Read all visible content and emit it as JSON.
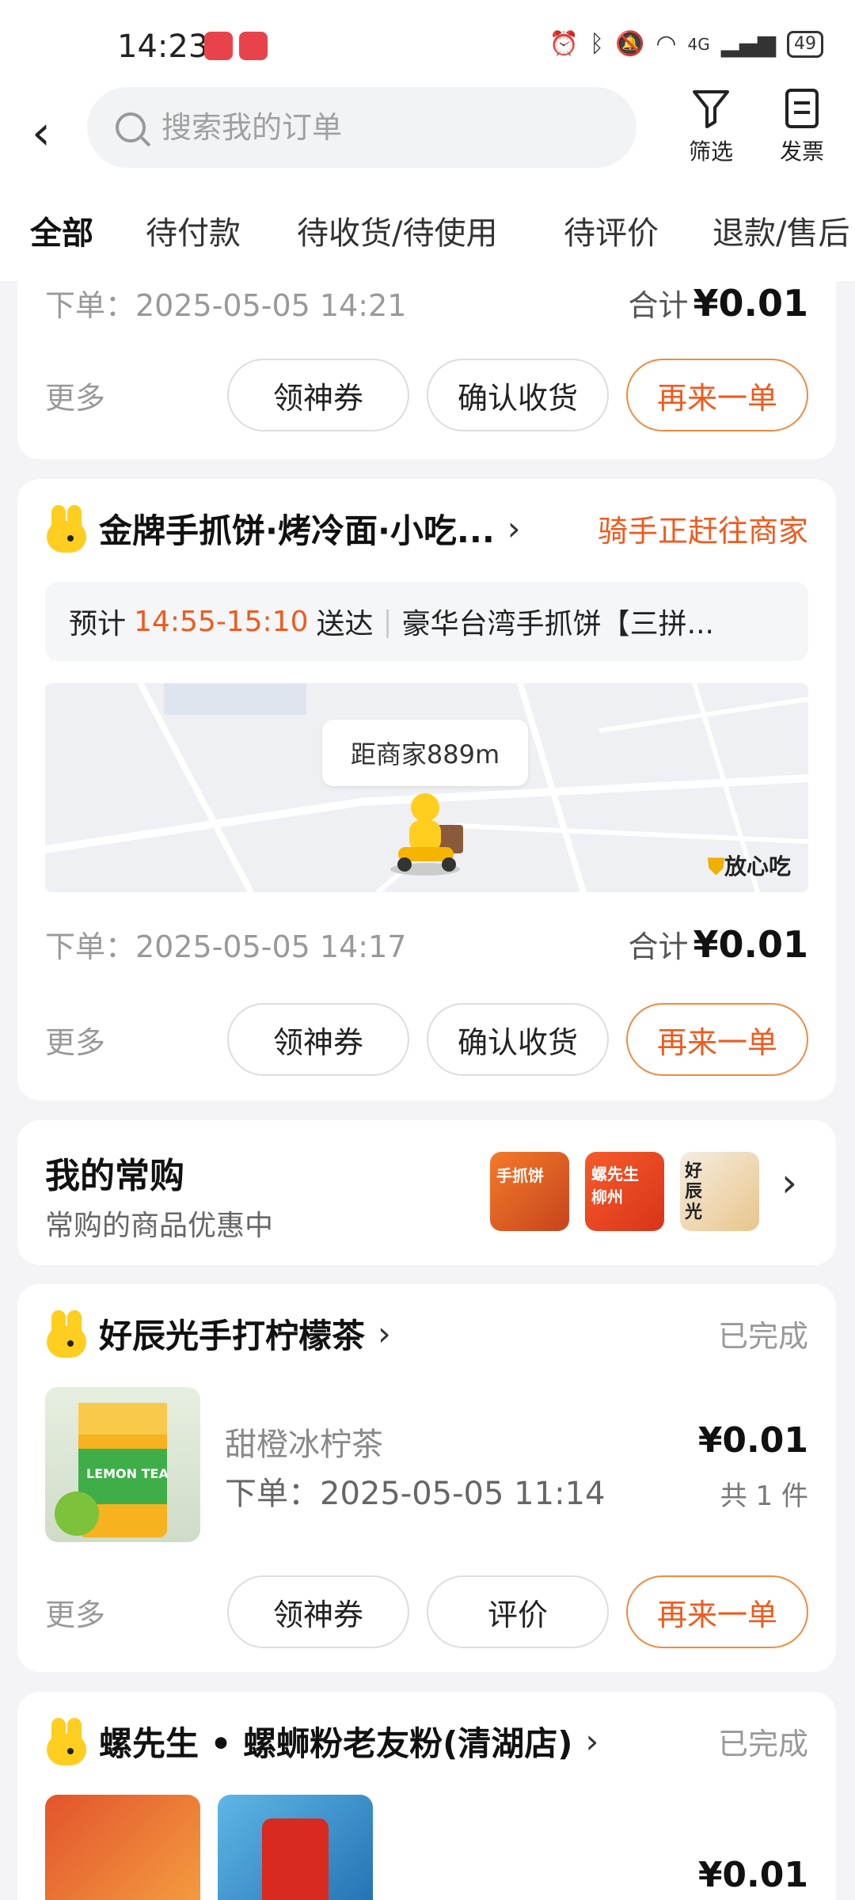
{
  "status_bar": {
    "time": "14:23",
    "battery": "49",
    "network": "4G"
  },
  "header": {
    "search_placeholder": "搜索我的订单",
    "filter_label": "筛选",
    "invoice_label": "发票"
  },
  "tabs": [
    "全部",
    "待付款",
    "待收货/待使用",
    "待评价",
    "退款/售后"
  ],
  "colors": {
    "accent": "#f05a1e",
    "tab_underline": "#ffd100",
    "brand_yellow": "#ffce1f"
  },
  "order1": {
    "order_time": "下单：2025-05-05 14:21",
    "total_label": "合计",
    "total": "¥0.01",
    "more": "更多",
    "buttons": [
      "领神券",
      "确认收货",
      "再来一单"
    ]
  },
  "order2": {
    "store": "金牌手抓饼·烤冷面·小吃...",
    "status": "骑手正赶往商家",
    "eta_prefix": "预计",
    "eta_time": "14:55-15:10",
    "eta_suffix": "送达",
    "item_summary": "豪华台湾手抓饼【三拼...",
    "map_distance": "距商家889m",
    "map_badge": "放心吃",
    "order_time": "下单：2025-05-05 14:17",
    "total_label": "合计",
    "total": "¥0.01",
    "more": "更多",
    "buttons": [
      "领神券",
      "确认收货",
      "再来一单"
    ]
  },
  "favorites": {
    "title": "我的常购",
    "subtitle": "常购的商品优惠中",
    "thumbs": [
      "手抓饼",
      "螺先生 柳州",
      "好辰光"
    ]
  },
  "order3": {
    "store": "好辰光手打柠檬茶",
    "status": "已完成",
    "product_image_text": "LEMON TEA",
    "item_name": "甜橙冰柠茶",
    "order_time": "下单：2025-05-05 11:14",
    "price": "¥0.01",
    "qty": "共 1 件",
    "more": "更多",
    "buttons": [
      "领神券",
      "评价",
      "再来一单"
    ]
  },
  "order4": {
    "store": "螺先生 • 螺蛳粉老友粉(清湖店)",
    "status": "已完成",
    "price": "¥0.01"
  }
}
